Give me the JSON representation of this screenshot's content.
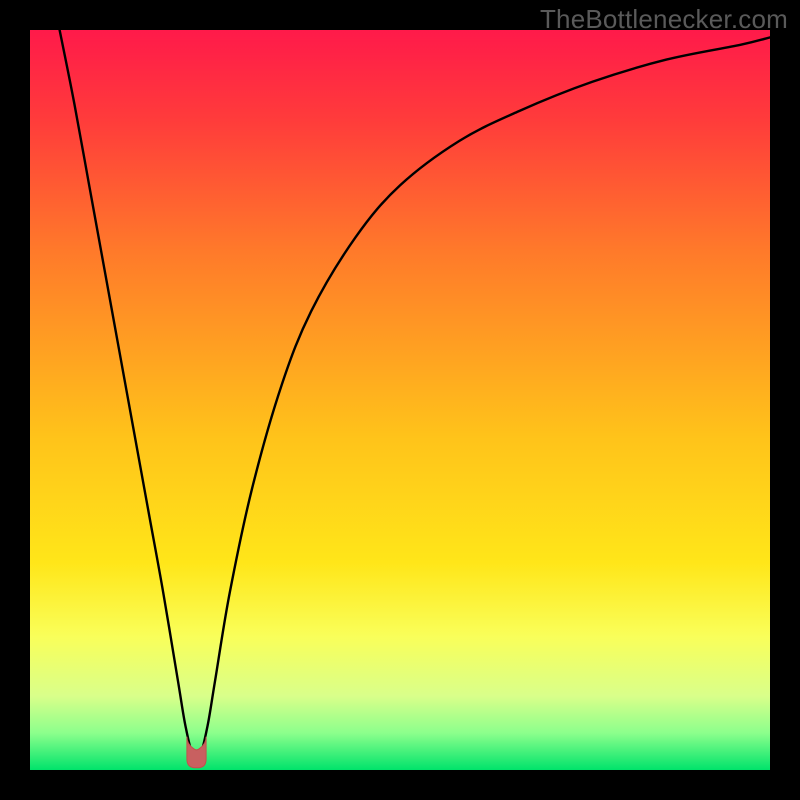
{
  "watermark": {
    "text": "TheBottlenecker.com"
  },
  "chart_data": {
    "type": "line",
    "title": "",
    "xlabel": "",
    "ylabel": "",
    "xlim": [
      0,
      100
    ],
    "ylim": [
      0,
      100
    ],
    "grid": false,
    "legend": false,
    "background_gradient": {
      "stops": [
        {
          "pct": 0,
          "color": "#ff1a4a"
        },
        {
          "pct": 12,
          "color": "#ff3b3b"
        },
        {
          "pct": 30,
          "color": "#ff7a2a"
        },
        {
          "pct": 55,
          "color": "#ffc31a"
        },
        {
          "pct": 72,
          "color": "#ffe619"
        },
        {
          "pct": 82,
          "color": "#f9ff5a"
        },
        {
          "pct": 90,
          "color": "#d9ff8a"
        },
        {
          "pct": 95,
          "color": "#8cff8c"
        },
        {
          "pct": 100,
          "color": "#00e36b"
        }
      ]
    },
    "series": [
      {
        "name": "bottleneck-curve",
        "color": "#000000",
        "x": [
          4,
          6,
          8,
          10,
          12,
          14,
          16,
          18,
          20,
          21,
          22,
          23,
          24,
          25,
          27,
          30,
          34,
          38,
          44,
          50,
          58,
          66,
          76,
          86,
          96,
          100
        ],
        "y": [
          100,
          90,
          79,
          68,
          57,
          46,
          35,
          24,
          12,
          6,
          2,
          2,
          6,
          12,
          24,
          38,
          52,
          62,
          72,
          79,
          85,
          89,
          93,
          96,
          98,
          99
        ]
      }
    ],
    "marker": {
      "name": "optimal-point-marker",
      "x_range": [
        21.2,
        23.8
      ],
      "y_top": 4.5,
      "y_bottom": 0.3,
      "color": "#c86060"
    }
  }
}
